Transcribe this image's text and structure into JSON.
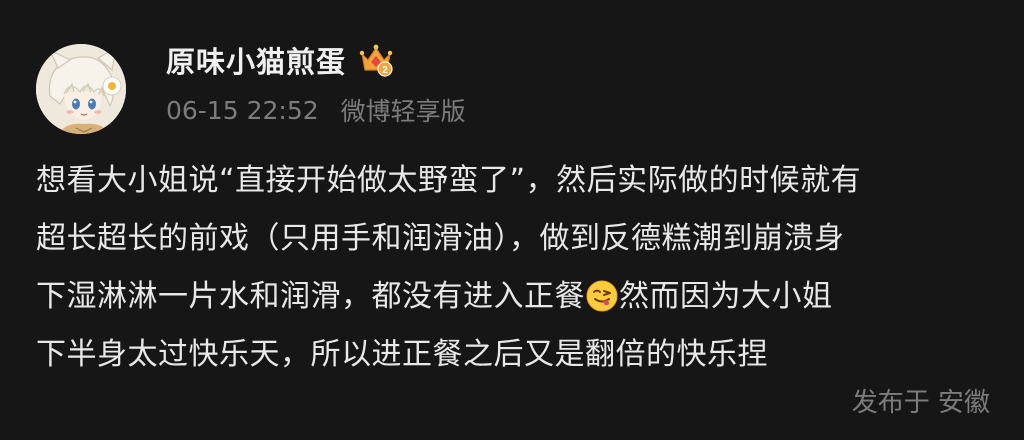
{
  "post": {
    "author": {
      "name": "原味小猫煎蛋",
      "avatar_icon": "anime-cat-girl-avatar",
      "badge_icon": "vip-crown-icon",
      "badge_level": "2",
      "badge_color": "#f2a33c"
    },
    "time": "06-15 22:52",
    "source": "微博轻享版",
    "content": {
      "line1": "想看大小姐说“直接开始做太野蛮了”，然后实际做的时候就有",
      "line2": "超长超长的前戏（只用手和润滑油），做到反德糕潮到崩溃身",
      "line3a": "下湿淋淋一片水和润滑，都没有进入正餐",
      "line3_emoji": "winking-tongue-emoji",
      "line3b": "然而因为大小姐",
      "line4": "下半身太过快乐天，所以进正餐之后又是翻倍的快乐捏"
    },
    "location": "发布于 安徽"
  },
  "colors": {
    "background": "#161616",
    "text": "#e8e8e8",
    "muted": "#7c7c7c"
  }
}
